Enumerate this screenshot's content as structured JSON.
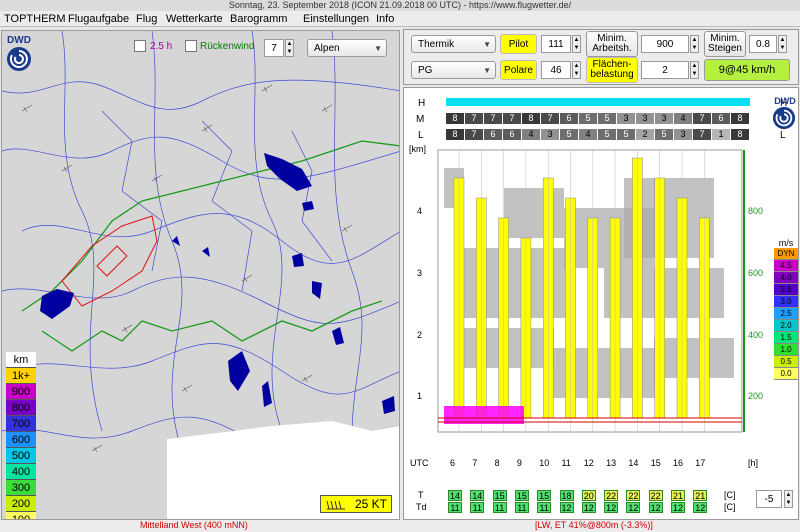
{
  "window": {
    "title": "Sonntag, 23. September 2018 (ICON 21.09.2018 00 UTC) - https://www.flugwetter.de/"
  },
  "menu": [
    "TOPTHERM",
    "Flugaufgabe",
    "Flug",
    "Wetterkarte",
    "Barogramm",
    "Einstellungen",
    "Info"
  ],
  "map": {
    "option_2_5h": "2.5 h",
    "rueckenwind": "Rückenwind",
    "level_value": "7",
    "region": "Alpen",
    "logo": "DWD",
    "wind_label": "25 KT",
    "legend_title": "km",
    "legend": [
      {
        "label": "1k+",
        "color": "#ffd200"
      },
      {
        "label": "900",
        "color": "#c800c8"
      },
      {
        "label": "800",
        "color": "#7800c8"
      },
      {
        "label": "700",
        "color": "#3232dc"
      },
      {
        "label": "600",
        "color": "#1e90ff"
      },
      {
        "label": "500",
        "color": "#00c8e6"
      },
      {
        "label": "400",
        "color": "#00e6a0"
      },
      {
        "label": "300",
        "color": "#3cdc3c"
      },
      {
        "label": "200",
        "color": "#c8f000"
      },
      {
        "label": "100",
        "color": "#ffff64"
      }
    ]
  },
  "controls": {
    "mode": "Thermik",
    "pilot_label": "Pilot",
    "pilot_value": "111",
    "min_work_label": "Minim. Arbeitsh.",
    "min_work_value": "900",
    "min_climb_label": "Minim. Steigen",
    "min_climb_value": "0.8",
    "aircraft": "PG",
    "polare_label": "Polare",
    "polare_value": "46",
    "wing_load_label": "Flächen-belastung",
    "wing_load_value": "2",
    "result": "9@45 km/h"
  },
  "meteogram": {
    "logo": "DWD",
    "rows": [
      "H",
      "M",
      "L"
    ],
    "m_values": [
      "8",
      "7",
      "7",
      "7",
      "8",
      "7",
      "6",
      "5",
      "5",
      "3",
      "3",
      "3",
      "4",
      "7",
      "6",
      "8"
    ],
    "l_values": [
      "8",
      "7",
      "6",
      "6",
      "4",
      "3",
      "5",
      "4",
      "5",
      "5",
      "2",
      "5",
      "3",
      "7",
      "1",
      "8"
    ],
    "km_label": "[km]",
    "km_ticks": [
      "4",
      "3",
      "2",
      "1"
    ],
    "m_ticks": [
      "800",
      "600",
      "400",
      "200"
    ],
    "ms_label": "m/s",
    "ms_scale": [
      {
        "label": "DYN",
        "color": "#ff9900"
      },
      {
        "label": "4.5",
        "color": "#c800c8"
      },
      {
        "label": "4.0",
        "color": "#8000c0"
      },
      {
        "label": "3.5",
        "color": "#5000c8"
      },
      {
        "label": "3.0",
        "color": "#3232ff"
      },
      {
        "label": "2.5",
        "color": "#1ea0ff"
      },
      {
        "label": "2.0",
        "color": "#00c8c8"
      },
      {
        "label": "1.5",
        "color": "#00e678"
      },
      {
        "label": "1.0",
        "color": "#30e030"
      },
      {
        "label": "0.5",
        "color": "#c8f000"
      },
      {
        "label": "0.0",
        "color": "#ffff60"
      }
    ],
    "utc_label": "UTC",
    "hours": [
      "6",
      "7",
      "8",
      "9",
      "10",
      "11",
      "12",
      "13",
      "14",
      "15",
      "16",
      "17"
    ],
    "h_label": "[h]",
    "t_label": "T",
    "td_label": "Td",
    "T": [
      "14",
      "14",
      "15",
      "15",
      "15",
      "18",
      "20",
      "22",
      "22",
      "22",
      "21",
      "21"
    ],
    "Td": [
      "11",
      "11",
      "11",
      "11",
      "11",
      "12",
      "12",
      "12",
      "12",
      "12",
      "12",
      "12"
    ],
    "c_unit": "[C]",
    "offset_value": "-5"
  },
  "status": {
    "left": "Mittelland West (400 mNN)",
    "right": "[LW, ET  41%@800m (-3.3%)]"
  }
}
